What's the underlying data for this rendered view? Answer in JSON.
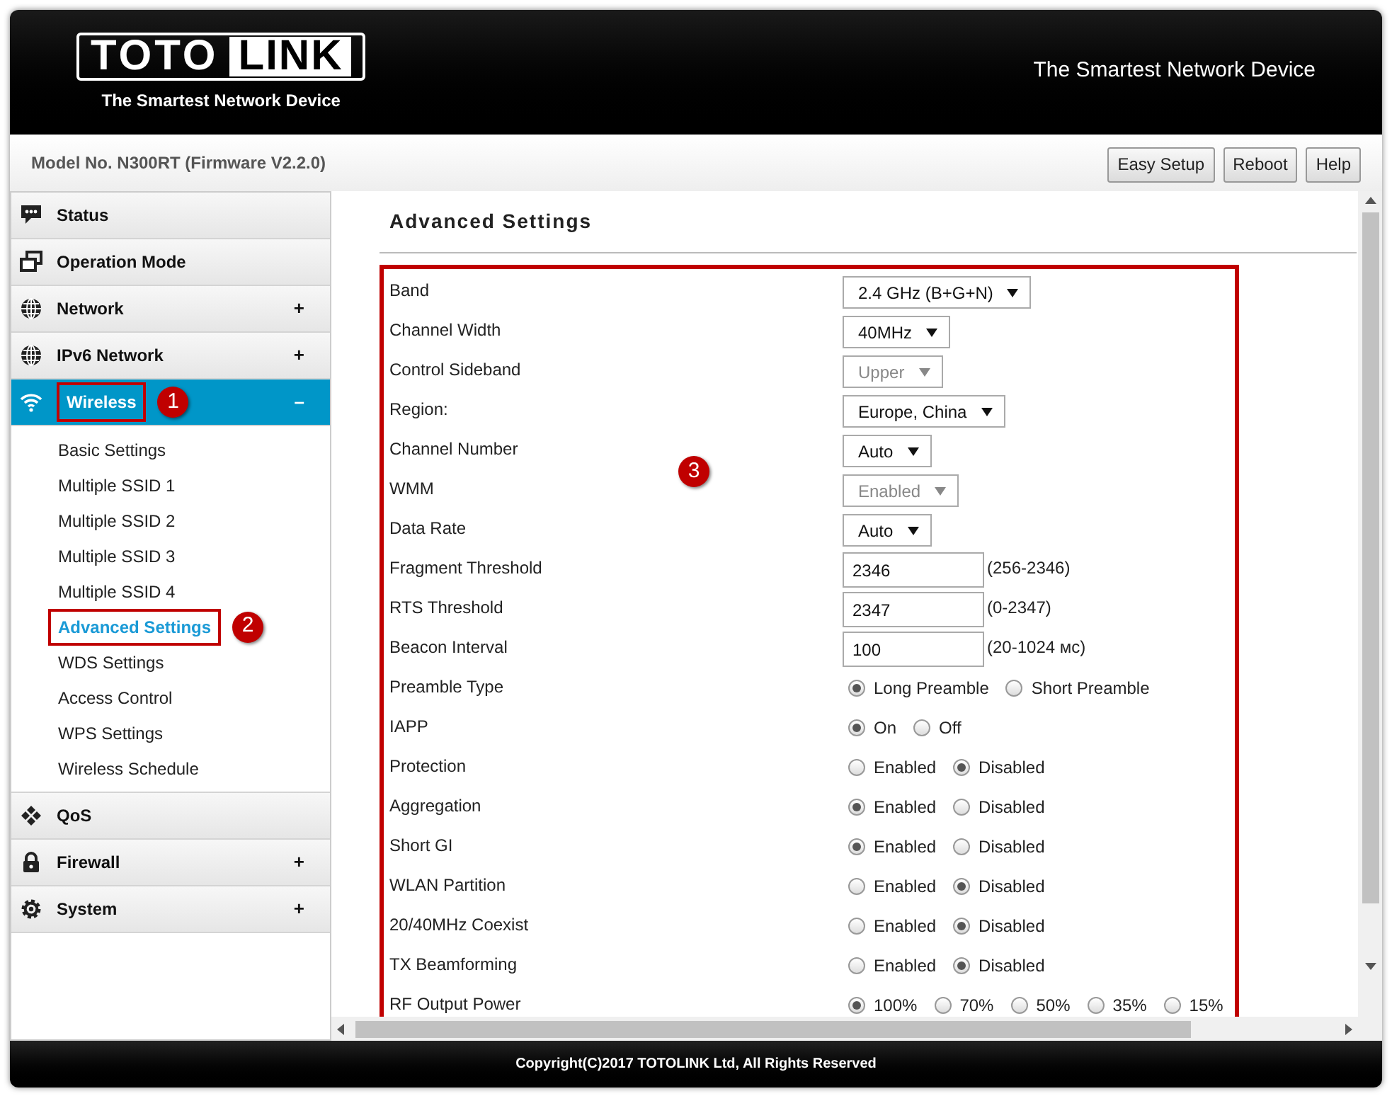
{
  "header": {
    "logo": {
      "left": "TOTO",
      "right": "LINK"
    },
    "tagline": "The Smartest Network Device",
    "slogan": "The Smartest Network Device"
  },
  "model_bar": {
    "model": "Model No. N300RT (Firmware V2.2.0)",
    "buttons": [
      "Easy Setup",
      "Reboot",
      "Help"
    ]
  },
  "sidebar": {
    "items": [
      {
        "label": "Status",
        "kind": "chat",
        "selected": false
      },
      {
        "label": "Operation Mode",
        "kind": "windows",
        "selected": false
      },
      {
        "label": "Network",
        "kind": "globe",
        "expander": "+",
        "selected": false
      },
      {
        "label": "IPv6 Network",
        "kind": "globe",
        "expander": "+",
        "selected": false
      },
      {
        "label": "Wireless",
        "kind": "wifi",
        "expander": "–",
        "selected": true,
        "callout": "1",
        "children": [
          {
            "label": "Basic Settings",
            "selected": false
          },
          {
            "label": "Multiple SSID 1",
            "selected": false
          },
          {
            "label": "Multiple SSID 2",
            "selected": false
          },
          {
            "label": "Multiple SSID 3",
            "selected": false
          },
          {
            "label": "Multiple SSID 4",
            "selected": false
          },
          {
            "label": "Advanced Settings",
            "selected": true,
            "callout": "2"
          },
          {
            "label": "WDS Settings",
            "selected": false
          },
          {
            "label": "Access Control",
            "selected": false
          },
          {
            "label": "WPS Settings",
            "selected": false
          },
          {
            "label": "Wireless Schedule",
            "selected": false
          }
        ]
      },
      {
        "label": "QoS",
        "kind": "qos",
        "selected": false
      },
      {
        "label": "Firewall",
        "kind": "lock",
        "expander": "+",
        "selected": false
      },
      {
        "label": "System",
        "kind": "gear",
        "expander": "+",
        "selected": false
      }
    ]
  },
  "content": {
    "title": "Advanced Settings",
    "callout": "3",
    "settings": [
      {
        "label": "Band",
        "kind": "select",
        "value": "2.4 GHz (B+G+N)",
        "disabled": false
      },
      {
        "label": "Channel Width",
        "kind": "select",
        "value": "40MHz",
        "disabled": false
      },
      {
        "label": "Control Sideband",
        "kind": "select",
        "value": "Upper",
        "disabled": true
      },
      {
        "label": "Region:",
        "kind": "select",
        "value": "Europe, China",
        "disabled": false
      },
      {
        "label": "Channel Number",
        "kind": "select",
        "value": "Auto",
        "disabled": false
      },
      {
        "label": "WMM",
        "kind": "select",
        "value": "Enabled",
        "disabled": true
      },
      {
        "label": "Data Rate",
        "kind": "select",
        "value": "Auto",
        "disabled": false
      },
      {
        "label": "Fragment Threshold",
        "kind": "text",
        "value": "2346",
        "hint": "(256-2346)"
      },
      {
        "label": "RTS Threshold",
        "kind": "text",
        "value": "2347",
        "hint": "(0-2347)"
      },
      {
        "label": "Beacon Interval",
        "kind": "text",
        "value": "100",
        "hint": "(20-1024 мс)"
      },
      {
        "label": "Preamble Type",
        "kind": "radio",
        "options": [
          {
            "label": "Long Preamble",
            "selected": true
          },
          {
            "label": "Short Preamble",
            "selected": false
          }
        ]
      },
      {
        "label": "IAPP",
        "kind": "radio",
        "options": [
          {
            "label": "On",
            "selected": true
          },
          {
            "label": "Off",
            "selected": false
          }
        ]
      },
      {
        "label": "Protection",
        "kind": "radio",
        "options": [
          {
            "label": "Enabled",
            "selected": false
          },
          {
            "label": "Disabled",
            "selected": true
          }
        ]
      },
      {
        "label": "Aggregation",
        "kind": "radio",
        "options": [
          {
            "label": "Enabled",
            "selected": true
          },
          {
            "label": "Disabled",
            "selected": false
          }
        ]
      },
      {
        "label": "Short GI",
        "kind": "radio",
        "options": [
          {
            "label": "Enabled",
            "selected": true
          },
          {
            "label": "Disabled",
            "selected": false
          }
        ]
      },
      {
        "label": "WLAN Partition",
        "kind": "radio",
        "options": [
          {
            "label": "Enabled",
            "selected": false
          },
          {
            "label": "Disabled",
            "selected": true
          }
        ]
      },
      {
        "label": "20/40MHz Coexist",
        "kind": "radio",
        "options": [
          {
            "label": "Enabled",
            "selected": false
          },
          {
            "label": "Disabled",
            "selected": true
          }
        ]
      },
      {
        "label": "TX Beamforming",
        "kind": "radio",
        "options": [
          {
            "label": "Enabled",
            "selected": false
          },
          {
            "label": "Disabled",
            "selected": true
          }
        ]
      },
      {
        "label": "RF Output Power",
        "kind": "radio",
        "options": [
          {
            "label": "100%",
            "selected": true
          },
          {
            "label": "70%",
            "selected": false
          },
          {
            "label": "50%",
            "selected": false
          },
          {
            "label": "35%",
            "selected": false
          },
          {
            "label": "15%",
            "selected": false
          }
        ]
      }
    ]
  },
  "footer": "Copyright(C)2017 TOTOLINK Ltd, All Rights Reserved"
}
